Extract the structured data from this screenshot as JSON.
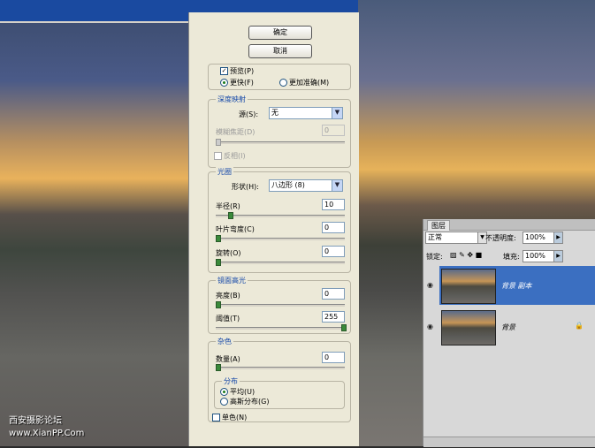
{
  "buttons": {
    "ok": "确定",
    "cancel": "取消"
  },
  "preview": {
    "label": "预览",
    "shortcut": "(P)",
    "faster": "更快",
    "faster_key": "(F)",
    "accurate": "更加准确",
    "accurate_key": "(M)"
  },
  "depth_map": {
    "title": "深度映射",
    "source_label": "源(S):",
    "source_value": "无",
    "blur_focal_label": "模糊焦距",
    "blur_focal_key": "(D)",
    "blur_focal_value": "0",
    "invert_label": "反相",
    "invert_key": "(I)"
  },
  "iris": {
    "title": "光圈",
    "shape_label": "形状",
    "shape_key": "(H):",
    "shape_value": "八边形 (8)",
    "radius_label": "半径",
    "radius_key": "(R)",
    "radius_value": "10",
    "curvature_label": "叶片弯度",
    "curvature_key": "(C)",
    "curvature_value": "0",
    "rotation_label": "旋转",
    "rotation_key": "(O)",
    "rotation_value": "0"
  },
  "specular": {
    "title": "镜面高光",
    "brightness_label": "亮度",
    "brightness_key": "(B)",
    "brightness_value": "0",
    "threshold_label": "阈值",
    "threshold_key": "(T)",
    "threshold_value": "255"
  },
  "noise": {
    "title": "杂色",
    "amount_label": "数量",
    "amount_key": "(A)",
    "amount_value": "0",
    "distribution_title": "分布",
    "uniform": "平均",
    "uniform_key": "(U)",
    "gaussian": "高斯分布",
    "gaussian_key": "(G)",
    "mono_label": "单色",
    "mono_key": "(N)"
  },
  "layers": {
    "tab": "图层",
    "blend_mode": "正常",
    "opacity_label": "不透明度:",
    "opacity_value": "100%",
    "lock_label": "锁定:",
    "fill_label": "填充:",
    "fill_value": "100%",
    "items": [
      {
        "name": "背景 副本",
        "active": true
      },
      {
        "name": "背景",
        "active": false
      }
    ]
  },
  "watermark": {
    "line1": "西安摄影论坛",
    "line2": "www.XianPP.Com"
  }
}
